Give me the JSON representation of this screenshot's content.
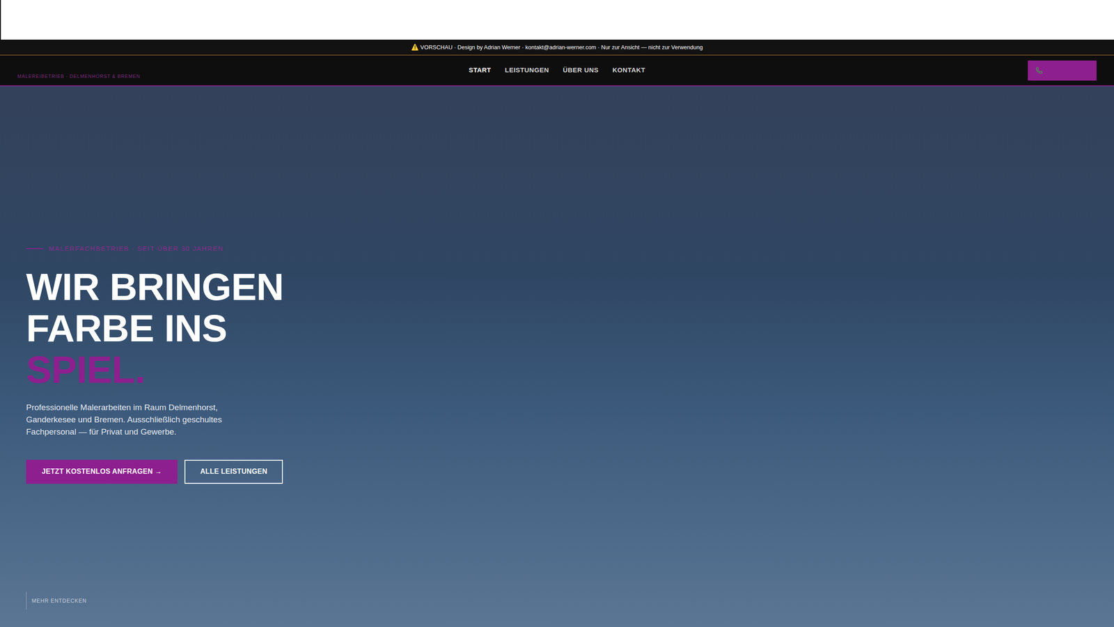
{
  "banner": {
    "icon": "⚠️",
    "text": "VORSCHAU · Design by Adrian Werner · kontakt@adrian-werner.com · Nur zur Ansicht — nicht zur Verwendung"
  },
  "nav": {
    "brand": "MALEREIBETRIEB · DELMENHORST & BREMEN",
    "items": [
      {
        "label": "START",
        "selected": true
      },
      {
        "label": "LEISTUNGEN",
        "selected": false
      },
      {
        "label": "ÜBER UNS",
        "selected": false
      },
      {
        "label": "KONTAKT",
        "selected": false
      }
    ]
  },
  "hero": {
    "eyebrow": "MALERFACHBETRIEB · SEIT ÜBER 30 JAHREN",
    "heading": [
      {
        "text": "WIR BRINGEN",
        "accent": false
      },
      {
        "text": "FARBE INS",
        "accent": false
      },
      {
        "text": "SPIEL.",
        "accent": true
      }
    ],
    "paragraph": "Professionelle Malerarbeiten im Raum Delmenhorst, Ganderkesee und Bremen. Ausschließlich geschultes Fachpersonal — für Privat und Gewerbe.",
    "buttons": [
      {
        "label": "JETZT KOSTENLOS ANFRAGEN →",
        "kind": "primary"
      },
      {
        "label": "ALLE LEISTUNGEN",
        "kind": "outline"
      }
    ],
    "scroll_hint": "MEHR ENTDECKEN"
  }
}
